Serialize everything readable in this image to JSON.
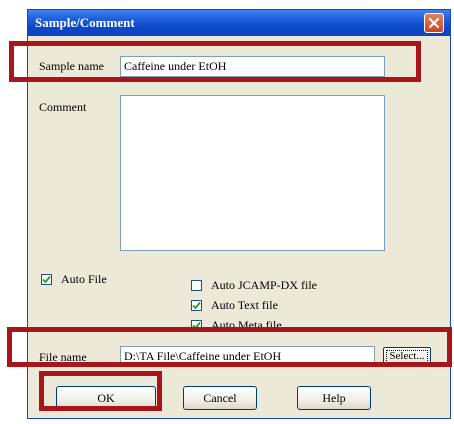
{
  "window": {
    "title": "Sample/Comment"
  },
  "sample": {
    "label": "Sample name",
    "value": "Caffeine under EtOH"
  },
  "comment": {
    "label": "Comment",
    "value": ""
  },
  "auto_file": {
    "label": "Auto File",
    "checked": true
  },
  "options": [
    {
      "label": "Auto JCAMP-DX file",
      "checked": false
    },
    {
      "label": "Auto Text file",
      "checked": true
    },
    {
      "label": "Auto Meta file",
      "checked": true
    }
  ],
  "file": {
    "label": "File name",
    "value": "D:\\TA File\\Caffeine under EtOH",
    "select_label": "Select..."
  },
  "buttons": {
    "ok": "OK",
    "cancel": "Cancel",
    "help": "Help"
  },
  "colors": {
    "highlight": "#a8161c",
    "title_bar": "#0a46c8",
    "dialog_bg": "#ece9d8"
  }
}
